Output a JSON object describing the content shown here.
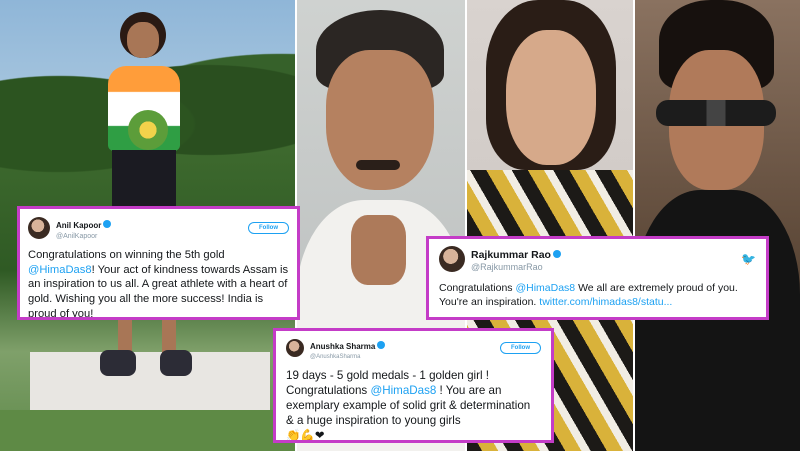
{
  "tweets": {
    "anil": {
      "name": "Anil Kapoor",
      "handle": "@AnilKapoor",
      "follow_label": "Follow",
      "text_before": "Congratulations on winning the 5th gold ",
      "mention": "@HimaDas8",
      "text_after": "! Your act of kindness towards Assam is an inspiration to us all. A great athlete with a heart of gold. Wishing you all the more success! India is proud of you!"
    },
    "rajkummar": {
      "name": "Rajkummar Rao",
      "handle": "@RajkummarRao",
      "text_before": "Congratulations ",
      "mention": "@HimaDas8",
      "text_mid": " We all are extremely proud of you. You're an inspiration. ",
      "link": "twitter.com/himadas8/statu..."
    },
    "anushka": {
      "name": "Anushka Sharma",
      "handle": "@AnushkaSharma",
      "follow_label": "Follow",
      "line1": "19 days - 5 gold medals - 1 golden girl !",
      "text_before": "Congratulations ",
      "mention": "@HimaDas8",
      "text_after": " ! You are an exemplary example of solid grit & determination & a huge inspiration to young girls",
      "emoji": "👏💪❤"
    }
  },
  "icons": {
    "twitter": "bird-icon",
    "verified": "verified-badge-icon"
  },
  "colors": {
    "tweet_border": "#c43cc7",
    "twitter_blue": "#1da1f2"
  }
}
